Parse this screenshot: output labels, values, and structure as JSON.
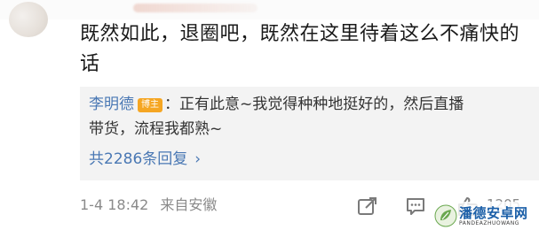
{
  "comment": {
    "text": "既然如此，退圈吧，既然在这里待着这么不痛快的话",
    "line1": "既然如此，退圈吧，既然在这里待着这么不痛快的",
    "line2": "话"
  },
  "reply": {
    "author": "李明德",
    "badge": "博主",
    "line1": "：正有此意~我觉得种种地挺好的，然后直播",
    "line2": "带货，流程我都熟~",
    "total_label": "共2286条回复",
    "chevron": "›"
  },
  "meta": {
    "timestamp": "1-4 18:42",
    "location": "来自安徽"
  },
  "actions": {
    "like_count": "1205"
  },
  "watermark": {
    "title": "潘德安卓网",
    "subtitle": "PANDEAZHUOWANG"
  },
  "colors": {
    "accent": "#4a78b4",
    "badge": "#f5a623",
    "reply_bg": "#f3f3f3",
    "meta_text": "#8a8a8a"
  },
  "icons": [
    "share-icon",
    "comment-icon",
    "like-icon",
    "watermark-logo-icon"
  ]
}
